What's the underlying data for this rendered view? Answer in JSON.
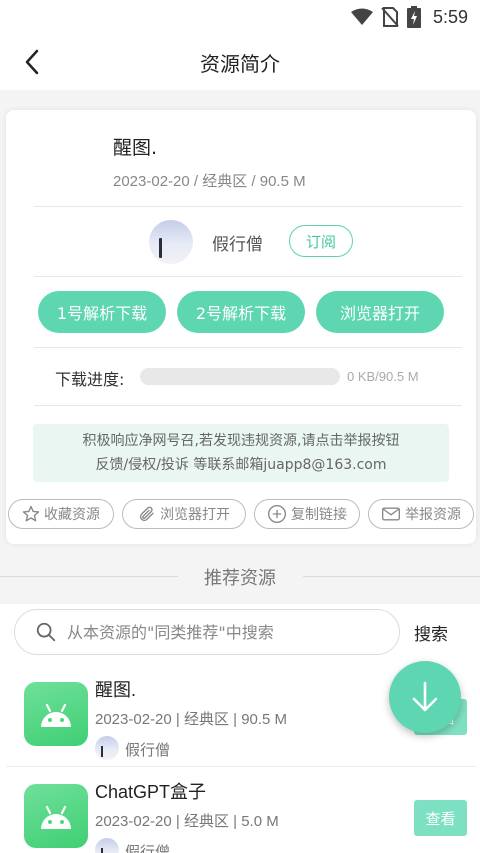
{
  "status_bar": {
    "time": "5:59"
  },
  "header": {
    "title": "资源简介"
  },
  "resource": {
    "name": "醒图.",
    "meta": "2023-02-20 / 经典区 / 90.5 M",
    "author": "假行僧",
    "subscribe_label": "订阅"
  },
  "download_buttons": [
    "1号解析下载",
    "2号解析下载",
    "浏览器打开"
  ],
  "progress": {
    "label": "下载进度:",
    "text": "0 KB/90.5 M",
    "fraction": 0.0
  },
  "notice": {
    "line1": "积极响应净网号召,若发现违规资源,请点击举报按钮",
    "line2": "反馈/侵权/投诉 等联系邮箱juapp8@163.com"
  },
  "actions": [
    {
      "label": "收藏资源",
      "icon": "star-icon"
    },
    {
      "label": "浏览器打开",
      "icon": "paperclip-icon"
    },
    {
      "label": "复制链接",
      "icon": "plus-circle-icon"
    },
    {
      "label": "举报资源",
      "icon": "mail-icon"
    }
  ],
  "recommend": {
    "section_title": "推荐资源",
    "search_placeholder": "从本资源的\"同类推荐\"中搜索",
    "search_button": "搜索",
    "items": [
      {
        "title": "醒图.",
        "meta": "2023-02-20 | 经典区 | 90.5 M",
        "author": "假行僧",
        "view_label": "查看"
      },
      {
        "title": "ChatGPT盒子",
        "meta": "2023-02-20 | 经典区 | 5.0 M",
        "author": "假行僧",
        "view_label": "查看"
      }
    ]
  },
  "colors": {
    "accent": "#5dd6b1",
    "app_icon": "#4fd57f",
    "notice_bg": "#e9f6f1"
  }
}
